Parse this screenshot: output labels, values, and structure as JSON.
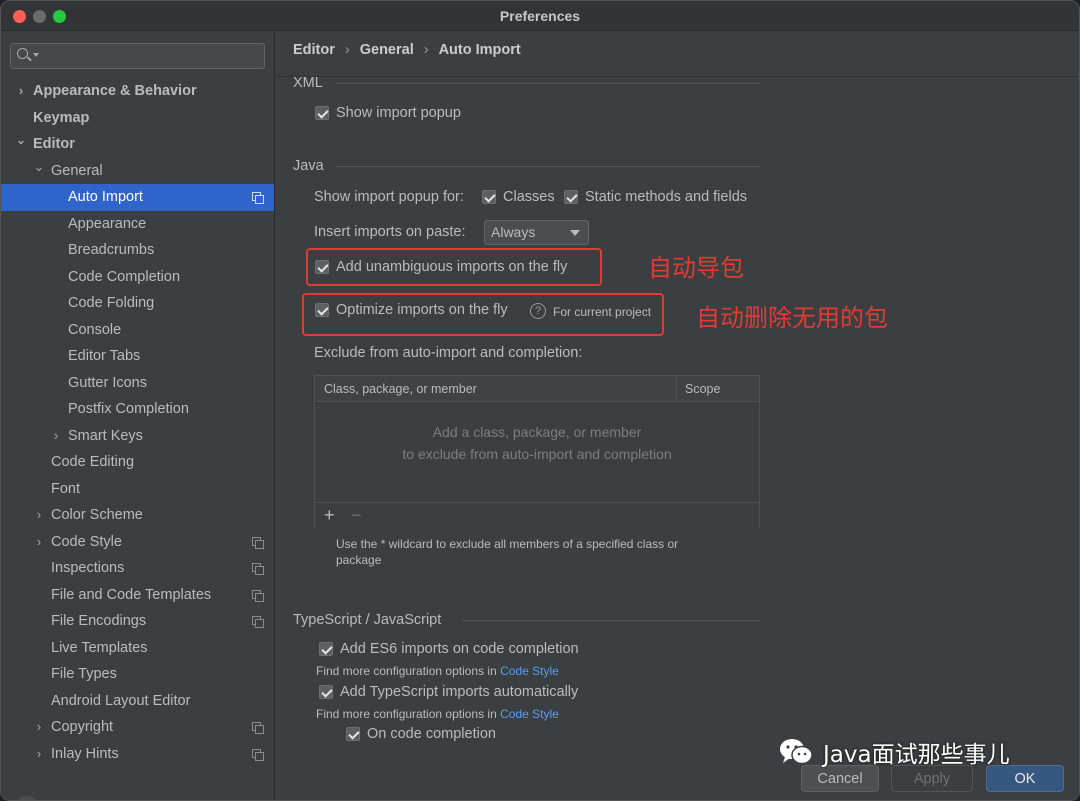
{
  "window": {
    "title": "Preferences"
  },
  "sidebar": {
    "items": [
      {
        "label": "Appearance & Behavior",
        "level": 0,
        "chevron": "right",
        "bold": true
      },
      {
        "label": "Keymap",
        "level": 0,
        "chevron": "",
        "bold": true
      },
      {
        "label": "Editor",
        "level": 0,
        "chevron": "down",
        "bold": true
      },
      {
        "label": "General",
        "level": 1,
        "chevron": "down"
      },
      {
        "label": "Auto Import",
        "level": 2,
        "chevron": "",
        "selected": true,
        "copy": true
      },
      {
        "label": "Appearance",
        "level": 2,
        "chevron": ""
      },
      {
        "label": "Breadcrumbs",
        "level": 2,
        "chevron": ""
      },
      {
        "label": "Code Completion",
        "level": 2,
        "chevron": ""
      },
      {
        "label": "Code Folding",
        "level": 2,
        "chevron": ""
      },
      {
        "label": "Console",
        "level": 2,
        "chevron": ""
      },
      {
        "label": "Editor Tabs",
        "level": 2,
        "chevron": ""
      },
      {
        "label": "Gutter Icons",
        "level": 2,
        "chevron": ""
      },
      {
        "label": "Postfix Completion",
        "level": 2,
        "chevron": ""
      },
      {
        "label": "Smart Keys",
        "level": 2,
        "chevron": "right"
      },
      {
        "label": "Code Editing",
        "level": 1,
        "chevron": ""
      },
      {
        "label": "Font",
        "level": 1,
        "chevron": ""
      },
      {
        "label": "Color Scheme",
        "level": 1,
        "chevron": "right"
      },
      {
        "label": "Code Style",
        "level": 1,
        "chevron": "right",
        "copy": true
      },
      {
        "label": "Inspections",
        "level": 1,
        "chevron": "",
        "copy": true
      },
      {
        "label": "File and Code Templates",
        "level": 1,
        "chevron": "",
        "copy": true
      },
      {
        "label": "File Encodings",
        "level": 1,
        "chevron": "",
        "copy": true
      },
      {
        "label": "Live Templates",
        "level": 1,
        "chevron": ""
      },
      {
        "label": "File Types",
        "level": 1,
        "chevron": ""
      },
      {
        "label": "Android Layout Editor",
        "level": 1,
        "chevron": ""
      },
      {
        "label": "Copyright",
        "level": 1,
        "chevron": "right",
        "copy": true
      },
      {
        "label": "Inlay Hints",
        "level": 1,
        "chevron": "right",
        "copy": true
      }
    ],
    "help_label": "?"
  },
  "breadcrumb": {
    "parts": [
      "Editor",
      "General",
      "Auto Import"
    ],
    "separator": "›"
  },
  "xml": {
    "section_title": "XML",
    "show_import_popup": "Show import popup"
  },
  "java": {
    "section_title": "Java",
    "show_popup_for": "Show import popup for:",
    "classes": "Classes",
    "static_methods": "Static methods and fields",
    "insert_on_paste": "Insert imports on paste:",
    "insert_value": "Always",
    "add_unambiguous": "Add unambiguous imports on the fly",
    "optimize": "Optimize imports on the fly",
    "optimize_hint": "For current project",
    "exclude_label": "Exclude from auto-import and completion:",
    "table": {
      "col1": "Class, package, or member",
      "col2": "Scope",
      "empty_line1": "Add a class, package, or member",
      "empty_line2": "to exclude from auto-import and completion",
      "add": "+",
      "remove": "−"
    },
    "wildcard_hint_1": "Use the * wildcard to exclude all members of a specified class or",
    "wildcard_hint_2": "package"
  },
  "ts": {
    "section_title": "TypeScript / JavaScript",
    "es6": "Add ES6 imports on code completion",
    "find_more_1": "Find more configuration options in",
    "code_style_link_1": "Code Style",
    "ts_auto": "Add TypeScript imports automatically",
    "find_more_2": "Find more configuration options in",
    "code_style_link_2": "Code Style",
    "on_completion": "On code completion"
  },
  "annotations": {
    "auto_import": "自动导包",
    "auto_remove": "自动删除无用的包"
  },
  "buttons": {
    "cancel": "Cancel",
    "apply": "Apply",
    "ok": "OK"
  },
  "watermark": "Java面试那些事儿",
  "colors": {
    "selection": "#2f65ca",
    "link": "#589df6",
    "annotation": "#e03c32",
    "ok_button": "#365880"
  }
}
